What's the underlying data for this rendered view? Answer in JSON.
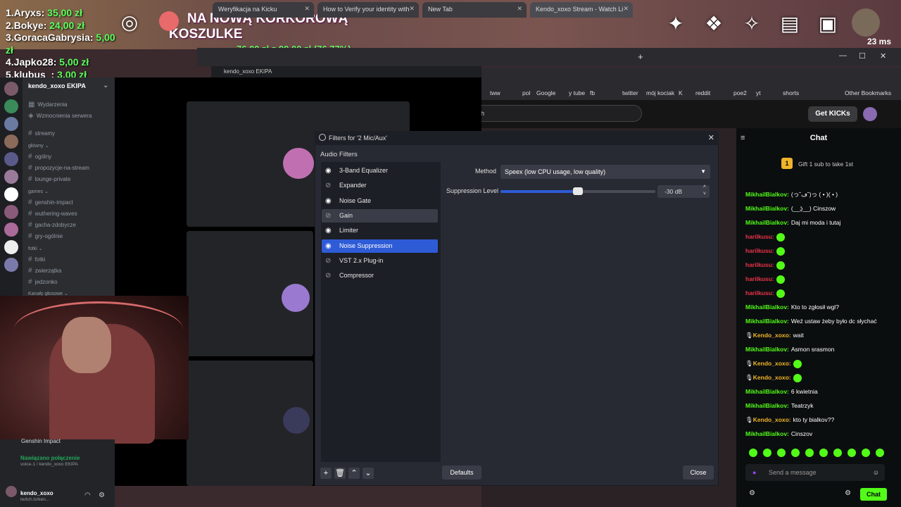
{
  "hud": {
    "leaderboard": [
      {
        "rank": "1.",
        "name": "Aryxs:",
        "amount": "35,00 zł"
      },
      {
        "rank": "2.",
        "name": "Bokye:",
        "amount": "24,00 zł"
      },
      {
        "rank": "3.",
        "name": "GoracaGabrysia:",
        "amount": "5,00 zł"
      },
      {
        "rank": "4.",
        "name": "Japko28:",
        "amount": "5,00 zł"
      },
      {
        "rank": "5.",
        "name": "klubus_:",
        "amount": "3,00 zł"
      }
    ],
    "banner_title": "NA NOWĄ KORKOROWĄ KOSZULKE",
    "banner_progress": "76,00 zł z 99,00 zł (76.77%)",
    "ping": "23 ms"
  },
  "browser": {
    "tabs": [
      {
        "label": "Weryfikacja na Kicku"
      },
      {
        "label": "How to Verify your identity with"
      },
      {
        "label": "New Tab"
      },
      {
        "label": "Kendo_xoxo Stream - Watch Li"
      }
    ],
    "bookmarks": [
      "tww",
      "pol",
      "Google",
      "y tube",
      "fb",
      "twitter",
      "mój kociak",
      "K",
      "reddit",
      "poe2",
      "yt",
      "shorts",
      "Other Bookmarks"
    ],
    "search_text": "h",
    "kick_button": "Get KICKs"
  },
  "discord": {
    "window_title": "kendo_xoxo EKIPA",
    "server_name": "kendo_xoxo EKIPA",
    "channels": [
      {
        "label": "Wydarzenia",
        "type": "event"
      },
      {
        "label": "Wzmocnienia serwera",
        "type": "boost"
      },
      {
        "label": "streamy",
        "type": "text"
      },
      {
        "label": "główny",
        "type": "category"
      },
      {
        "label": "ogólny",
        "type": "text"
      },
      {
        "label": "propozycje-na-stream",
        "type": "text"
      },
      {
        "label": "lounge-private",
        "type": "text"
      },
      {
        "label": "games",
        "type": "category"
      },
      {
        "label": "genshin-impact",
        "type": "text"
      },
      {
        "label": "wuthering-waves",
        "type": "text"
      },
      {
        "label": "gacha-zdobycze",
        "type": "text"
      },
      {
        "label": "gry-ogólnie",
        "type": "text"
      },
      {
        "label": "fotki",
        "type": "category"
      },
      {
        "label": "fotki",
        "type": "text"
      },
      {
        "label": "zwierzątka",
        "type": "text"
      },
      {
        "label": "jedzonko",
        "type": "text"
      },
      {
        "label": "Kanały głosowe",
        "type": "category"
      }
    ],
    "activity": "Genshin Impact",
    "voice_status": "Nawiązano połączenie",
    "voice_sub": "voice-1 / kendo_xoxo EKIPA",
    "user_name": "kendo_xoxo",
    "user_sub": "twitch.tv/ken..."
  },
  "obs": {
    "title": "Filters for '2 Mic/Aux'",
    "section": "Audio Filters",
    "filters": [
      {
        "label": "3-Band Equalizer",
        "enabled": true,
        "state": ""
      },
      {
        "label": "Expander",
        "enabled": false,
        "state": ""
      },
      {
        "label": "Noise Gate",
        "enabled": true,
        "state": ""
      },
      {
        "label": "Gain",
        "enabled": false,
        "state": "hover"
      },
      {
        "label": "Limiter",
        "enabled": true,
        "state": ""
      },
      {
        "label": "Noise Suppression",
        "enabled": true,
        "state": "selected"
      },
      {
        "label": "VST 2.x Plug-in",
        "enabled": false,
        "state": ""
      },
      {
        "label": "Compressor",
        "enabled": false,
        "state": ""
      }
    ],
    "method_label": "Method",
    "method_value": "Speex (low CPU usage, low quality)",
    "suppression_label": "Suppression Level",
    "suppression_value": "-30 dB",
    "suppression_fraction": 0.5,
    "defaults_button": "Defaults",
    "close_button": "Close"
  },
  "chat": {
    "title": "Chat",
    "gift_rank": "1",
    "gift_text": "Gift 1 sub to take 1st",
    "messages": [
      {
        "user": "MikhailBialkov:",
        "text": "(っ˘ڡ˘)っ ( • )( • )",
        "color": "#53fc18"
      },
      {
        "user": "MikhailBialkov:",
        "text": "(__ʖ̯__) Cinszow",
        "color": "#53fc18"
      },
      {
        "user": "MikhailBialkov:",
        "text": "Daj mi moda i tutaj",
        "color": "#53fc18"
      },
      {
        "user": "harilkusu:",
        "text": "",
        "color": "#e8334a",
        "emote": true
      },
      {
        "user": "harilkusu:",
        "text": "",
        "color": "#e8334a",
        "emote": true
      },
      {
        "user": "harilkusu:",
        "text": "",
        "color": "#e8334a",
        "emote": true
      },
      {
        "user": "harilkusu:",
        "text": "",
        "color": "#e8334a",
        "emote": true
      },
      {
        "user": "harilkusu:",
        "text": "",
        "color": "#e8334a",
        "emote": true
      },
      {
        "user": "MikhailBialkov:",
        "text": "Kto to zgłosił wgl?",
        "color": "#53fc18"
      },
      {
        "user": "MikhailBialkov:",
        "text": "Weź ustaw żeby było dc słychać",
        "color": "#53fc18"
      },
      {
        "user": "Kendo_xoxo:",
        "text": "wait",
        "color": "#f0b429"
      },
      {
        "user": "MikhailBialkov:",
        "text": "Asmon srasmon",
        "color": "#53fc18"
      },
      {
        "user": "Kendo_xoxo:",
        "text": "",
        "color": "#f0b429",
        "emote": true
      },
      {
        "user": "Kendo_xoxo:",
        "text": "",
        "color": "#f0b429",
        "emote": true
      },
      {
        "user": "MikhailBialkov:",
        "text": "6 kwietnia",
        "color": "#53fc18"
      },
      {
        "user": "MikhailBialkov:",
        "text": "Teatrzyk",
        "color": "#53fc18"
      },
      {
        "user": "Kendo_xoxo:",
        "text": "kto ty bialkov??",
        "color": "#f0b429"
      },
      {
        "user": "MikhailBialkov:",
        "text": "Cinszov",
        "color": "#53fc18"
      }
    ],
    "input_placeholder": "Send a message",
    "send_button": "Chat"
  }
}
